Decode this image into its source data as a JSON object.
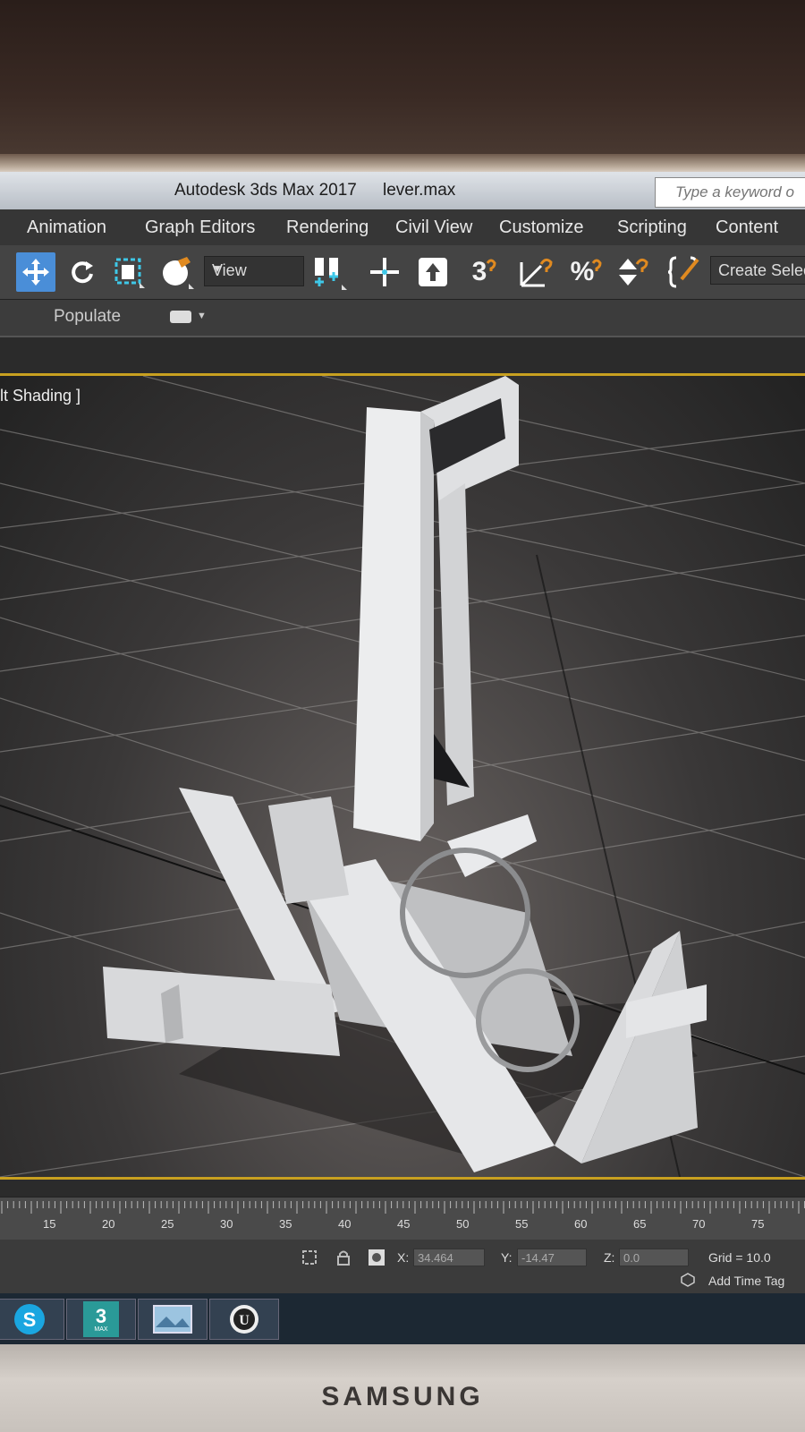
{
  "window": {
    "app_title": "Autodesk 3ds Max 2017",
    "file_name": "lever.max",
    "search_placeholder": "Type a keyword o"
  },
  "menu": {
    "items": [
      "Animation",
      "Graph Editors",
      "Rendering",
      "Civil View",
      "Customize",
      "Scripting",
      "Content"
    ]
  },
  "toolbar": {
    "view_dropdown": "View",
    "create_selection": "Create Selec",
    "snap_3_label": "3",
    "percent_label": "%"
  },
  "ribbon": {
    "populate_label": "Populate"
  },
  "viewport": {
    "label": "lt Shading ]"
  },
  "timeline": {
    "ticks": [
      "15",
      "20",
      "25",
      "30",
      "35",
      "40",
      "45",
      "50",
      "55",
      "60",
      "65",
      "70",
      "75"
    ]
  },
  "status": {
    "x_label": "X:",
    "x_value": "34.464",
    "y_label": "Y:",
    "y_value": "-14.47",
    "z_label": "Z:",
    "z_value": "0.0",
    "grid": "Grid = 10.0",
    "add_time_tag": "Add Time Tag"
  },
  "taskbar": {
    "max_label": "3",
    "max_sub": "MAX"
  },
  "monitor": {
    "brand": "SAMSUNG"
  },
  "colors": {
    "accent_blue": "#4a8ed8",
    "viewport_border": "#c8a020",
    "snap_orange": "#e08a20"
  }
}
